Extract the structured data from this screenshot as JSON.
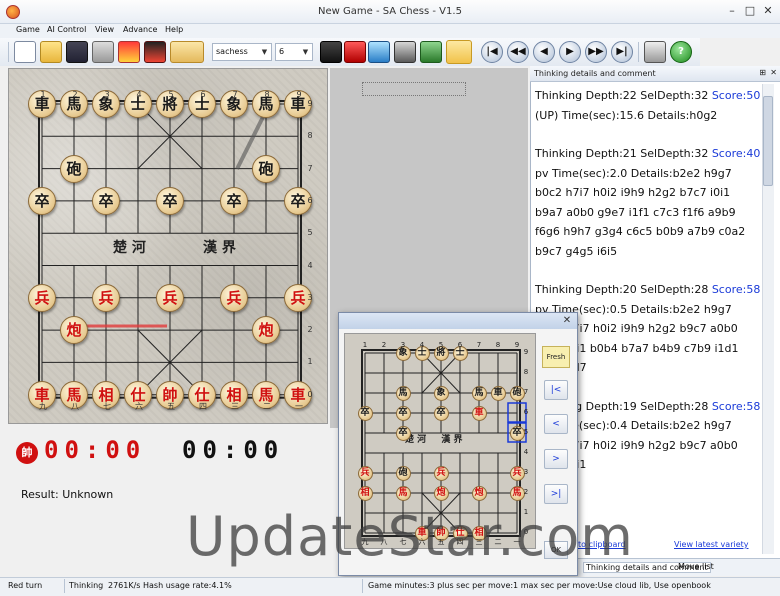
{
  "window": {
    "title": "New Game - SA Chess - V1.5",
    "controls": [
      "–",
      "□",
      "✕"
    ]
  },
  "menu": [
    "Game",
    "AI Control",
    "View",
    "Advance",
    "Help"
  ],
  "toolbar": {
    "engine": "sachess",
    "level": "6",
    "nav": [
      "|◀",
      "◀◀",
      "◀",
      "▶",
      "▶▶",
      "▶|"
    ],
    "help": "?"
  },
  "board": {
    "file_numbers_top": [
      "1",
      "2",
      "3",
      "4",
      "5",
      "6",
      "7",
      "8",
      "9"
    ],
    "file_numbers_bottom": [
      "九",
      "八",
      "七",
      "六",
      "五",
      "四",
      "三",
      "二",
      "一"
    ],
    "rank_numbers": [
      "9",
      "8",
      "7",
      "6",
      "5",
      "4",
      "3",
      "2",
      "1",
      "0"
    ],
    "river_left": "楚 河",
    "river_right": "漢 界",
    "pieces": [
      {
        "t": "車",
        "c": "black",
        "f": 0,
        "r": 0
      },
      {
        "t": "馬",
        "c": "black",
        "f": 1,
        "r": 0
      },
      {
        "t": "象",
        "c": "black",
        "f": 2,
        "r": 0
      },
      {
        "t": "士",
        "c": "black",
        "f": 3,
        "r": 0
      },
      {
        "t": "將",
        "c": "black",
        "f": 4,
        "r": 0
      },
      {
        "t": "士",
        "c": "black",
        "f": 5,
        "r": 0
      },
      {
        "t": "象",
        "c": "black",
        "f": 6,
        "r": 0
      },
      {
        "t": "馬",
        "c": "black",
        "f": 7,
        "r": 0
      },
      {
        "t": "車",
        "c": "black",
        "f": 8,
        "r": 0
      },
      {
        "t": "砲",
        "c": "black",
        "f": 1,
        "r": 2
      },
      {
        "t": "砲",
        "c": "black",
        "f": 7,
        "r": 2
      },
      {
        "t": "卒",
        "c": "black",
        "f": 0,
        "r": 3
      },
      {
        "t": "卒",
        "c": "black",
        "f": 2,
        "r": 3
      },
      {
        "t": "卒",
        "c": "black",
        "f": 4,
        "r": 3
      },
      {
        "t": "卒",
        "c": "black",
        "f": 6,
        "r": 3
      },
      {
        "t": "卒",
        "c": "black",
        "f": 8,
        "r": 3
      },
      {
        "t": "兵",
        "c": "red",
        "f": 0,
        "r": 6
      },
      {
        "t": "兵",
        "c": "red",
        "f": 2,
        "r": 6
      },
      {
        "t": "兵",
        "c": "red",
        "f": 4,
        "r": 6
      },
      {
        "t": "兵",
        "c": "red",
        "f": 6,
        "r": 6
      },
      {
        "t": "兵",
        "c": "red",
        "f": 8,
        "r": 6
      },
      {
        "t": "炮",
        "c": "red",
        "f": 1,
        "r": 7
      },
      {
        "t": "炮",
        "c": "red",
        "f": 7,
        "r": 7
      },
      {
        "t": "車",
        "c": "red",
        "f": 0,
        "r": 9
      },
      {
        "t": "馬",
        "c": "red",
        "f": 1,
        "r": 9
      },
      {
        "t": "相",
        "c": "red",
        "f": 2,
        "r": 9
      },
      {
        "t": "仕",
        "c": "red",
        "f": 3,
        "r": 9
      },
      {
        "t": "帥",
        "c": "red",
        "f": 4,
        "r": 9
      },
      {
        "t": "仕",
        "c": "red",
        "f": 5,
        "r": 9
      },
      {
        "t": "相",
        "c": "red",
        "f": 6,
        "r": 9
      },
      {
        "t": "馬",
        "c": "red",
        "f": 7,
        "r": 9
      },
      {
        "t": "車",
        "c": "red",
        "f": 8,
        "r": 9
      }
    ]
  },
  "clock": {
    "red_badge": "帥",
    "red_time": "00:00",
    "black_time": "00:00",
    "red_color": "#d01010",
    "black_color": "#111111"
  },
  "result": "Result: Unknown",
  "thinking": {
    "header": "Thinking details and comment",
    "entries": [
      {
        "line": "Thinking Depth:22 SelDepth:32 ",
        "score": "Score:50",
        "rest": "(UP) Time(sec):15.6 Details:h0g2"
      },
      {
        "line": "Thinking Depth:21 SelDepth:32 ",
        "score": "Score:40",
        "rest": "pv Time(sec):2.0 Details:b2e2 h9g7 b0c2 h7i7 h0i2 i9h9 h2g2 b7c7 i0i1 b9a7 a0b0 g9e7 i1f1 c7c3 f1f6 a9b9 f6g6 h9h7 g3g4 c6c5 b0b9 a7b9 c0a2 b9c7 g4g5 i6i5"
      },
      {
        "line": "Thinking Depth:20 SelDepth:28 ",
        "score": "Score:58",
        "rest": "pv Time(sec):0.5 Details:b2e2 h9g7 b0c2 h7i7 h0i2 i9h9 h2g2 b9c7 a0b0 a9b9 i0i1 b0b4 b7a7 b4b9 c7b9 i1d1 i7i3 d1d7"
      },
      {
        "line": "Thinking Depth:19 SelDepth:28 ",
        "score": "Score:58",
        "rest": "pv Time(sec):0.4 Details:b2e2 h9g7 b0c2 h7i7 h0i2 i9h9 h2g2 b9c7 a0b0 a9b9 i0i1"
      }
    ],
    "tab_active": "Thinking details and comment",
    "tab_other": "Move list",
    "link_clipboard": "to clipboard",
    "link_variety": "View latest variety"
  },
  "popup": {
    "fresh": "Fresh",
    "buttons": [
      "|<",
      "<",
      ">",
      ">|"
    ],
    "ok": "OK",
    "file_numbers_top": [
      "1",
      "2",
      "3",
      "4",
      "5",
      "6",
      "7",
      "8",
      "9"
    ],
    "file_numbers_bottom": [
      "九",
      "八",
      "七",
      "六",
      "五",
      "四",
      "三",
      "二",
      "一"
    ],
    "rank_numbers": [
      "9",
      "8",
      "7",
      "6",
      "5",
      "4",
      "3",
      "2",
      "1",
      "0"
    ],
    "river": "楚 河 　 漢 界",
    "pieces": [
      {
        "t": "象",
        "c": "black",
        "f": 2,
        "r": 0
      },
      {
        "t": "士",
        "c": "black",
        "f": 3,
        "r": 0
      },
      {
        "t": "將",
        "c": "black",
        "f": 4,
        "r": 0
      },
      {
        "t": "士",
        "c": "black",
        "f": 5,
        "r": 0
      },
      {
        "t": "馬",
        "c": "black",
        "f": 2,
        "r": 2
      },
      {
        "t": "象",
        "c": "black",
        "f": 4,
        "r": 2
      },
      {
        "t": "馬",
        "c": "black",
        "f": 6,
        "r": 2
      },
      {
        "t": "車",
        "c": "black",
        "f": 7,
        "r": 2
      },
      {
        "t": "砲",
        "c": "black",
        "f": 8,
        "r": 2
      },
      {
        "t": "卒",
        "c": "black",
        "f": 0,
        "r": 3
      },
      {
        "t": "卒",
        "c": "black",
        "f": 2,
        "r": 3
      },
      {
        "t": "卒",
        "c": "black",
        "f": 4,
        "r": 3
      },
      {
        "t": "車",
        "c": "red",
        "f": 6,
        "r": 3
      },
      {
        "t": "卒",
        "c": "black",
        "f": 8,
        "r": 4
      },
      {
        "t": "卒",
        "c": "black",
        "f": 2,
        "r": 4
      },
      {
        "t": "兵",
        "c": "red",
        "f": 0,
        "r": 6
      },
      {
        "t": "砲",
        "c": "black",
        "f": 2,
        "r": 6
      },
      {
        "t": "兵",
        "c": "red",
        "f": 4,
        "r": 6
      },
      {
        "t": "兵",
        "c": "red",
        "f": 8,
        "r": 6
      },
      {
        "t": "相",
        "c": "red",
        "f": 0,
        "r": 7
      },
      {
        "t": "馬",
        "c": "red",
        "f": 2,
        "r": 7
      },
      {
        "t": "炮",
        "c": "red",
        "f": 4,
        "r": 7
      },
      {
        "t": "炮",
        "c": "red",
        "f": 6,
        "r": 7
      },
      {
        "t": "馬",
        "c": "red",
        "f": 8,
        "r": 7
      },
      {
        "t": "車",
        "c": "red",
        "f": 3,
        "r": 9
      },
      {
        "t": "帥",
        "c": "red",
        "f": 4,
        "r": 9
      },
      {
        "t": "仕",
        "c": "red",
        "f": 5,
        "r": 9
      },
      {
        "t": "相",
        "c": "red",
        "f": 6,
        "r": 9
      }
    ]
  },
  "watermark": "UpdateStar.com",
  "status": {
    "turn": "Red turn",
    "engine": "Thinking",
    "speed": "2761K/s Hash usage rate:4.1%",
    "game": "Game minutes:3 plus sec per move:1 max sec per move:Use cloud lib,  Use openbook"
  }
}
